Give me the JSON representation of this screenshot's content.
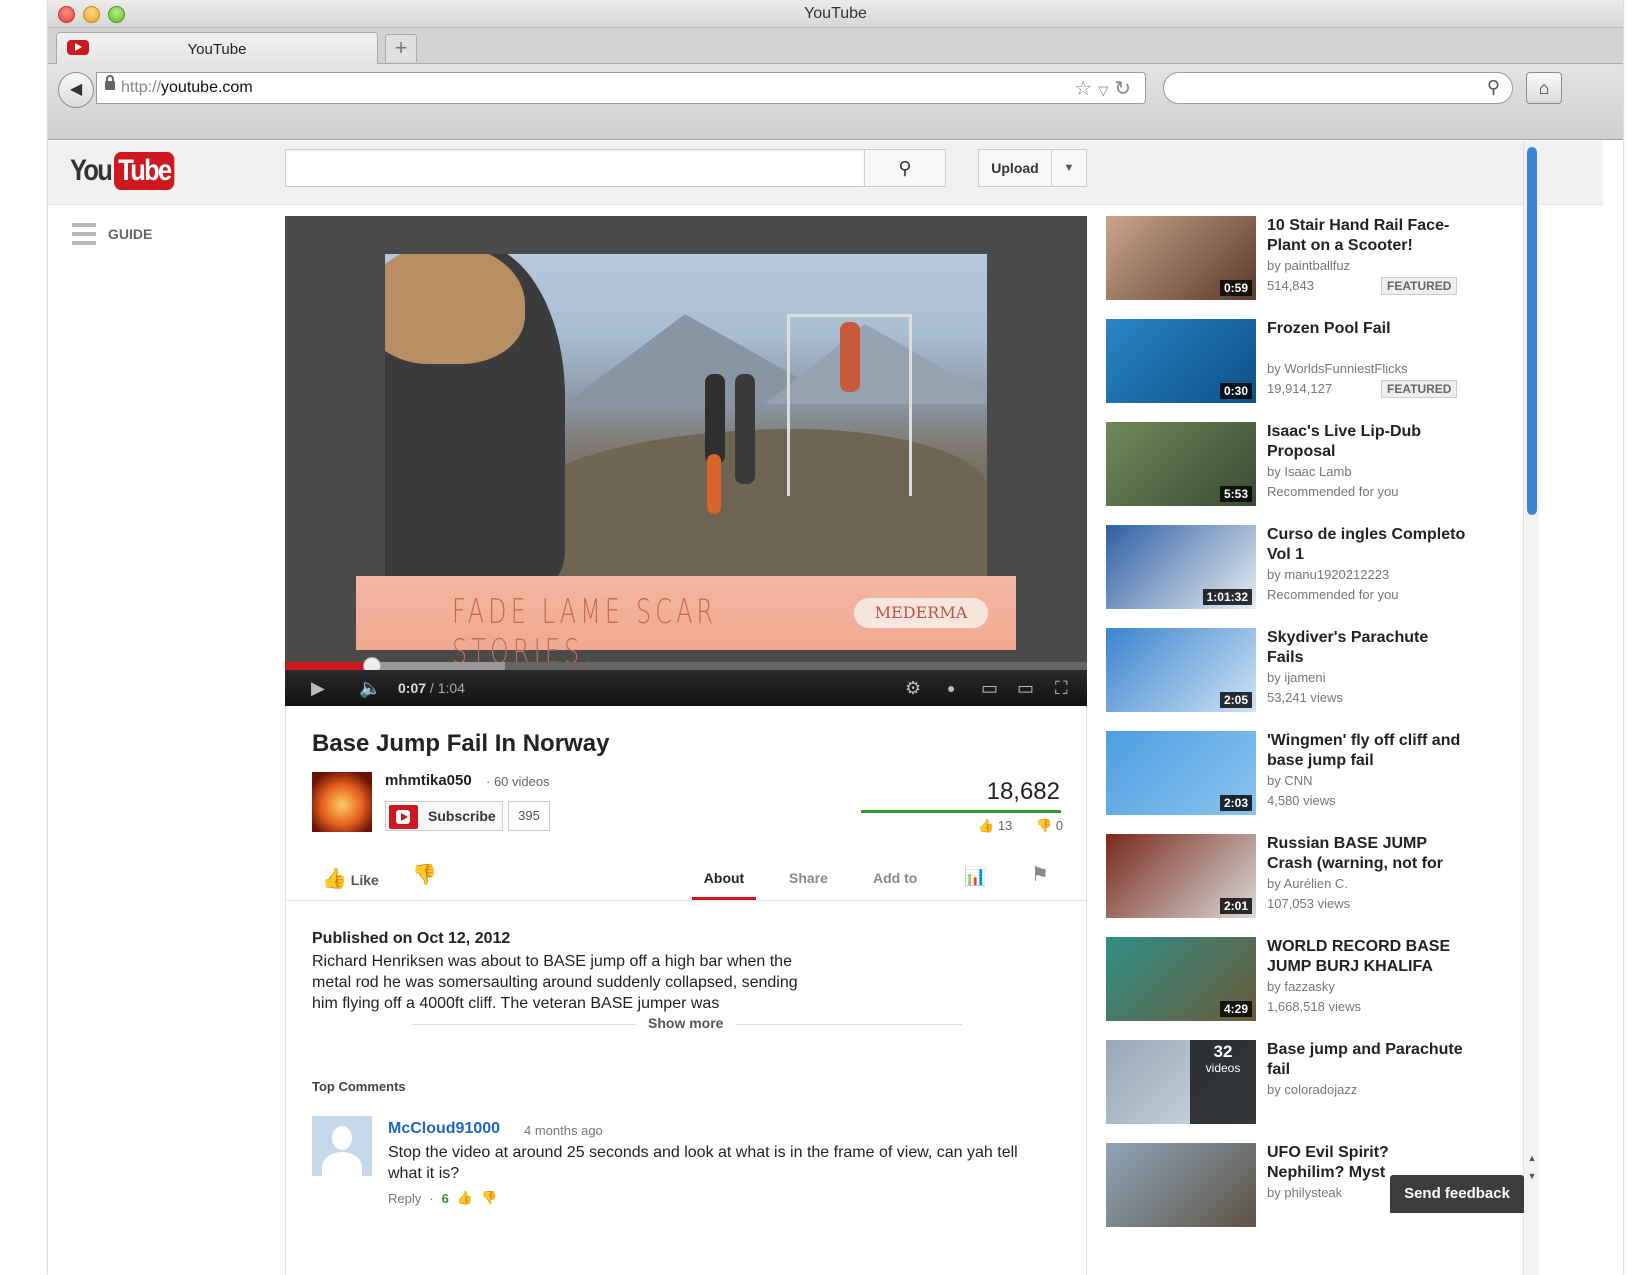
{
  "window": {
    "title": "YouTube"
  },
  "tabs": [
    {
      "label": "YouTube"
    }
  ],
  "newtab_label": "+",
  "address_bar": {
    "protocol": "http://",
    "host": "youtube.com"
  },
  "youtube": {
    "logo_you": "You",
    "logo_tube": "Tube",
    "upload_label": "Upload",
    "guide_label": "GUIDE"
  },
  "player": {
    "ad_text": "FADE LAME SCAR STORIES.",
    "ad_brand": "MEDERMA",
    "current_time": "0:07",
    "duration": "/ 1:04",
    "played_fraction": 0.109
  },
  "video": {
    "title": "Base Jump Fail In Norway",
    "channel": "mhmtika050",
    "channel_videos": "· 60 videos",
    "subscribe_label": "Subscribe",
    "subscriber_count": "395",
    "views": "18,682",
    "likes": "13",
    "dislikes": "0",
    "like_label": "Like",
    "tabs": {
      "about": "About",
      "share": "Share",
      "add_to": "Add to"
    },
    "published": "Published on Oct 12, 2012",
    "description": "Richard Henriksen was about to BASE jump off a high bar when the metal rod he was somersaulting around suddenly collapsed, sending him flying off a 4000ft cliff. The veteran BASE jumper was",
    "show_more": "Show more"
  },
  "comments": {
    "heading": "Top Comments",
    "items": [
      {
        "author": "McCloud91000",
        "time": "4 months ago",
        "text": "Stop the video at around 25 seconds and look at what is in the frame of view, can yah tell what it is?",
        "reply_label": "Reply",
        "separator": "·",
        "score": "6"
      }
    ]
  },
  "related": [
    {
      "title": "10 Stair Hand Rail Face-Plant on a Scooter!",
      "by": "by paintballfuz",
      "meta": "514,843",
      "badge": "FEATURED",
      "duration": "0:59",
      "thumb_colors": [
        "#c9a58a",
        "#5c3a2a"
      ]
    },
    {
      "title": "Frozen Pool Fail",
      "by": "by WorldsFunniestFlicks",
      "meta": "19,914,127",
      "badge": "FEATURED",
      "duration": "0:30",
      "thumb_colors": [
        "#2a86c6",
        "#0d4f86"
      ]
    },
    {
      "title": "Isaac's Live Lip-Dub Proposal",
      "by": "by Isaac Lamb",
      "meta": "Recommended for you",
      "badge": "",
      "duration": "5:53",
      "thumb_colors": [
        "#6e8a5a",
        "#3c4b33"
      ]
    },
    {
      "title": "Curso de ingles Completo Vol 1",
      "by": "by manu1920212223",
      "meta": "Recommended for you",
      "badge": "",
      "duration": "1:01:32",
      "thumb_colors": [
        "#2e5fa3",
        "#e9eef3"
      ]
    },
    {
      "title": "Skydiver's Parachute Fails",
      "by": "by ijameni",
      "meta": "53,241 views",
      "badge": "",
      "duration": "2:05",
      "thumb_colors": [
        "#3b84d0",
        "#cfe2f4"
      ]
    },
    {
      "title": "'Wingmen' fly off cliff and base jump fail",
      "by": "by CNN",
      "meta": "4,580 views",
      "badge": "",
      "duration": "2:03",
      "thumb_colors": [
        "#4d9ee0",
        "#8cc4ef"
      ]
    },
    {
      "title": "Russian BASE JUMP Crash (warning, not for",
      "by": "by Aurélien C.",
      "meta": "107,053 views",
      "badge": "",
      "duration": "2:01",
      "thumb_colors": [
        "#7a2a1c",
        "#d9d9d9"
      ]
    },
    {
      "title": "WORLD RECORD BASE JUMP BURJ KHALIFA",
      "by": "by fazzasky",
      "meta": "1,668,518 views",
      "badge": "",
      "duration": "4:29",
      "thumb_colors": [
        "#2f8f86",
        "#6b5a3a"
      ]
    },
    {
      "title": "Base jump and Parachute fail",
      "by": "by coloradojazz",
      "meta": "",
      "badge": "",
      "duration": "",
      "playlist_count": "32",
      "playlist_label": "videos",
      "thumb_colors": [
        "#97a8b8",
        "#d2dbe3"
      ]
    },
    {
      "title": "UFO Evil Spirit? Nephilim? Myst",
      "by": "by philysteak",
      "meta": "",
      "badge": "",
      "duration": "",
      "thumb_colors": [
        "#8fa4b8",
        "#5e5446"
      ]
    }
  ],
  "feedback_label": "Send feedback",
  "icons": {
    "back": "back-arrow-icon",
    "lock": "lock-icon",
    "bookmark": "star-icon",
    "reload": "reload-icon",
    "search": "search-icon",
    "home": "home-icon"
  }
}
